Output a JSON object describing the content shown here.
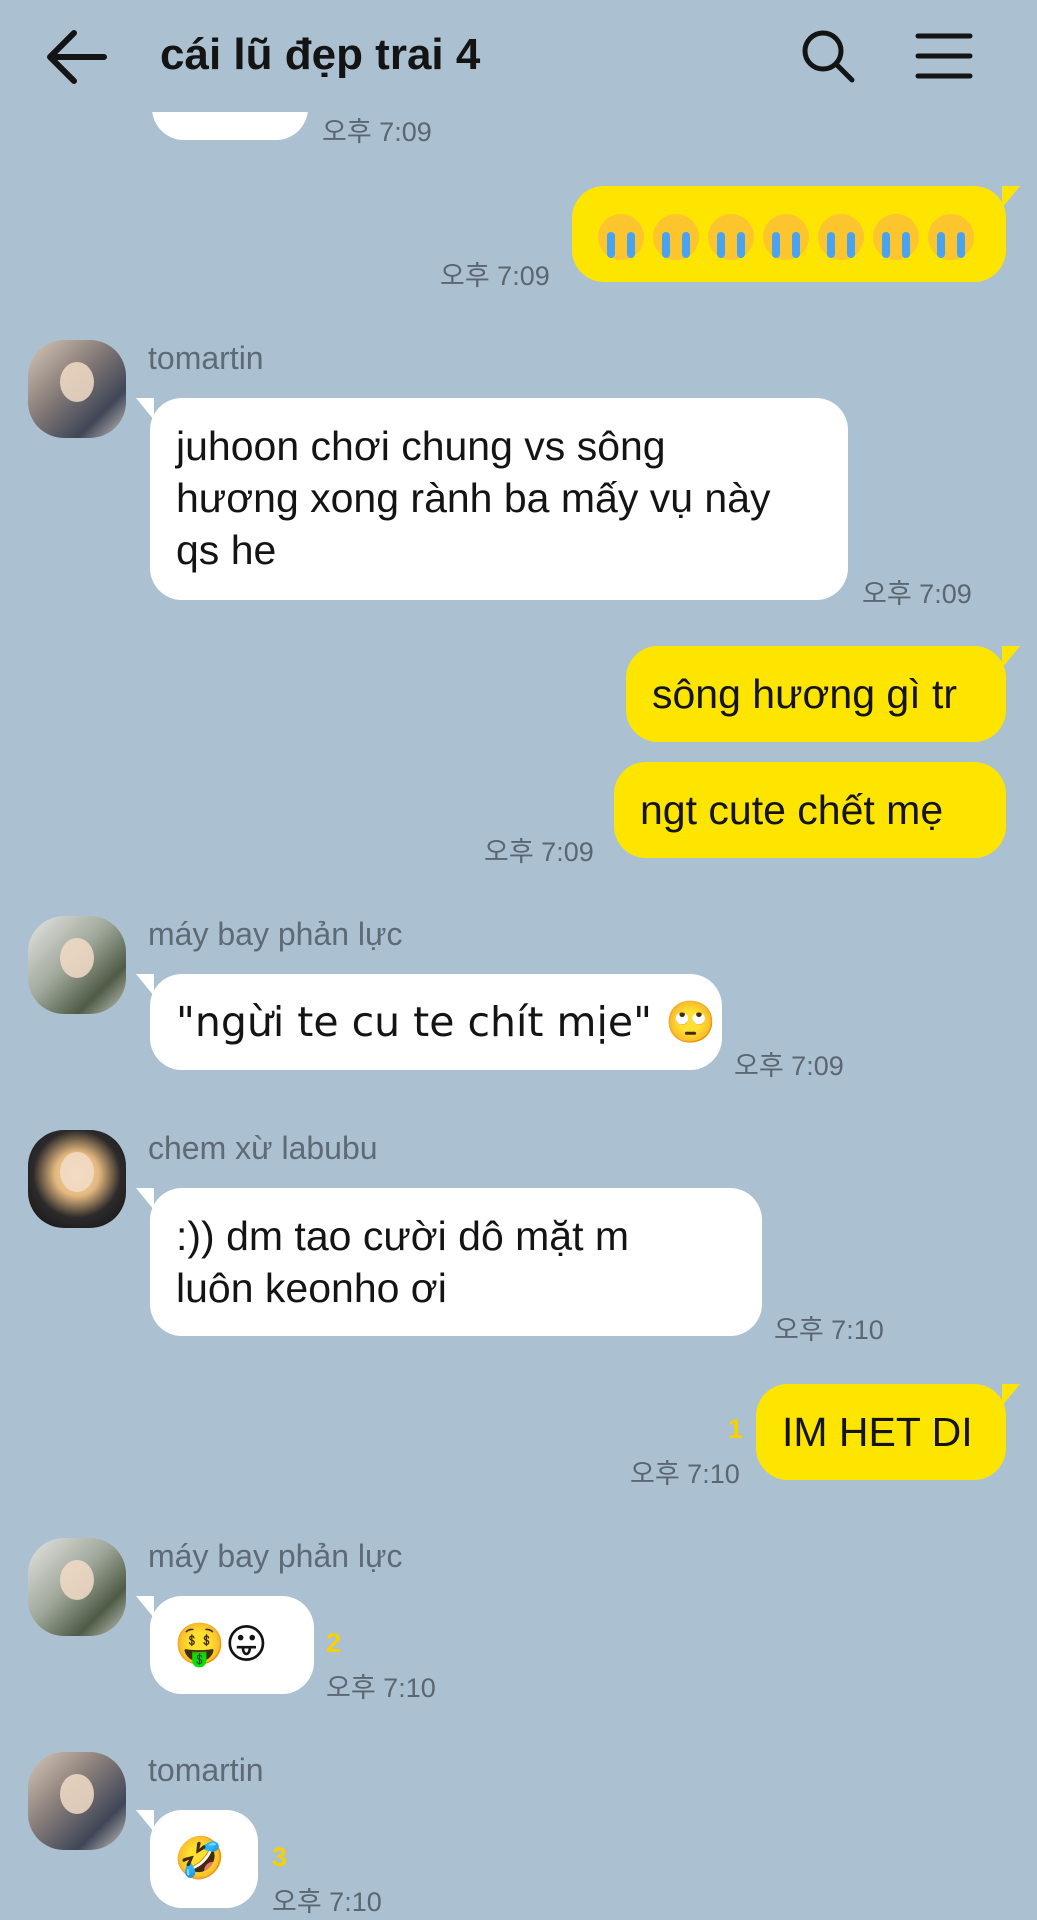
{
  "header": {
    "title": "cái lũ đẹp trai 4",
    "back_icon": "back-arrow-icon",
    "search_icon": "search-icon",
    "menu_icon": "hamburger-menu-icon"
  },
  "colors": {
    "background": "#abc1d1",
    "outgoing_bubble": "#fee500",
    "incoming_bubble": "#ffffff",
    "unread": "#f7d000"
  },
  "messages": [
    {
      "id": "m0",
      "direction": "in",
      "text": "",
      "time": "오후 7:09"
    },
    {
      "id": "m1",
      "direction": "out",
      "text": "😭😭😭😭😭😭😭",
      "time": "오후 7:09"
    },
    {
      "id": "m2",
      "direction": "in",
      "sender": "tomartin",
      "lines": [
        "juhoon chơi chung vs sông",
        "hương xong rành ba mấy vụ này",
        "qs he"
      ],
      "time": "오후 7:09"
    },
    {
      "id": "m3",
      "direction": "out",
      "text": "sông hương gì tr"
    },
    {
      "id": "m4",
      "direction": "out",
      "text": "ngt cute chết mẹ",
      "time": "오후 7:09"
    },
    {
      "id": "m5",
      "direction": "in",
      "sender": "máy bay phản lực",
      "text": "\"ngừi te cu te chít mịe\" 🙄",
      "time": "오후 7:09"
    },
    {
      "id": "m6",
      "direction": "in",
      "sender": "chem xừ labubu",
      "lines": [
        ":)) dm tao cười dô mặt m",
        "luôn keonho ơi"
      ],
      "time": "오후 7:10"
    },
    {
      "id": "m7",
      "direction": "out",
      "text": "IM HET DI",
      "unread": "1",
      "time": "오후 7:10"
    },
    {
      "id": "m8",
      "direction": "in",
      "sender": "máy bay phản lực",
      "text": "🤑😛",
      "unread": "2",
      "time": "오후 7:10"
    },
    {
      "id": "m9",
      "direction": "in",
      "sender": "tomartin",
      "text": "🤣",
      "unread": "3",
      "time": "오후 7:10"
    }
  ]
}
